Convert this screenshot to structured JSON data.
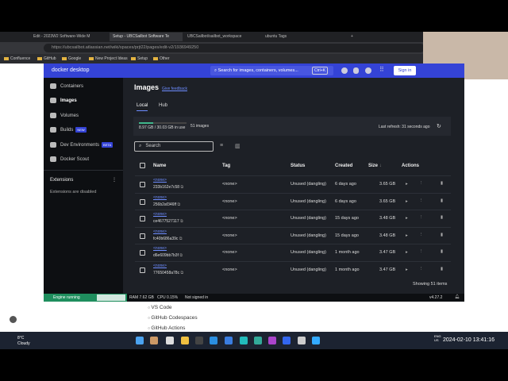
{
  "browser": {
    "tabs": [
      "Edit - 2023W2 Software-Wide M",
      "Setup - UBCSailbot Software Te",
      "UBCSailbot/sailbot_workspace",
      "ubuntu Tags"
    ],
    "url": "https://ubcsailbot.atlassian.net/wiki/spaces/prjt22/pages/edit-v2/1936949250",
    "bookmarks": [
      "Confluence",
      "GitHub",
      "Google",
      "New Project Ideas",
      "Setup",
      "Other"
    ]
  },
  "docker": {
    "brand": "docker desktop",
    "search_placeholder": "Search for images, containers, volumes...",
    "shortcut": "Ctrl+K",
    "sign_in": "Sign in",
    "sidebar": [
      {
        "label": "Containers"
      },
      {
        "label": "Images"
      },
      {
        "label": "Volumes"
      },
      {
        "label": "Builds",
        "badge": "NEW"
      },
      {
        "label": "Dev Environments",
        "badge": "BETA"
      },
      {
        "label": "Docker Scout"
      }
    ],
    "extensions_title": "Extensions",
    "extensions_note": "Extensions are disabled",
    "page_title": "Images",
    "feedback": "Give feedback",
    "tabs": [
      "Local",
      "Hub"
    ],
    "usage": "8.97 GB / 30.03 GB in use",
    "usage_fraction": 0.299,
    "image_count": "51 images",
    "last_refresh": "Last refresh: 31 seconds ago",
    "filter_placeholder": "Search",
    "columns": [
      "Name",
      "Tag",
      "Status",
      "Created",
      "Size",
      "Actions"
    ],
    "rows": [
      {
        "name": "<none>",
        "id": "233b162e7c58",
        "tag": "<none>",
        "status": "Unused (dangling)",
        "created": "6 days ago",
        "size": "3.65 GB"
      },
      {
        "name": "<none>",
        "id": "256b2af346ff",
        "tag": "<none>",
        "status": "Unused (dangling)",
        "created": "6 days ago",
        "size": "3.65 GB"
      },
      {
        "name": "<none>",
        "id": "ce4677527117",
        "tag": "<none>",
        "status": "Unused (dangling)",
        "created": "15 days ago",
        "size": "3.48 GB"
      },
      {
        "name": "<none>",
        "id": "fc40b686a39c",
        "tag": "<none>",
        "status": "Unused (dangling)",
        "created": "15 days ago",
        "size": "3.48 GB"
      },
      {
        "name": "<none>",
        "id": "d6e609bb7b3f",
        "tag": "<none>",
        "status": "Unused (dangling)",
        "created": "1 month ago",
        "size": "3.47 GB"
      },
      {
        "name": "<none>",
        "id": "77650458a78c",
        "tag": "<none>",
        "status": "Unused (dangling)",
        "created": "1 month ago",
        "size": "3.47 GB"
      }
    ],
    "showing": "Showing 51 items",
    "statusbar": {
      "engine": "Engine running",
      "ram": "RAM 7.62 GB",
      "cpu": "CPU 0.15%",
      "signed": "Not signed in",
      "version": "v4.27.2"
    }
  },
  "page_list": [
    "VS Code",
    "GitHub Codespaces",
    "GitHub Actions"
  ],
  "taskbar": {
    "temp": "8°C",
    "weather": "Cloudy",
    "lang": "ENG US",
    "datetime": "2024-02-10 13:41:16"
  },
  "colors": {
    "docker_blue": "#3443d6",
    "engine_green": "#1f8e5e"
  }
}
